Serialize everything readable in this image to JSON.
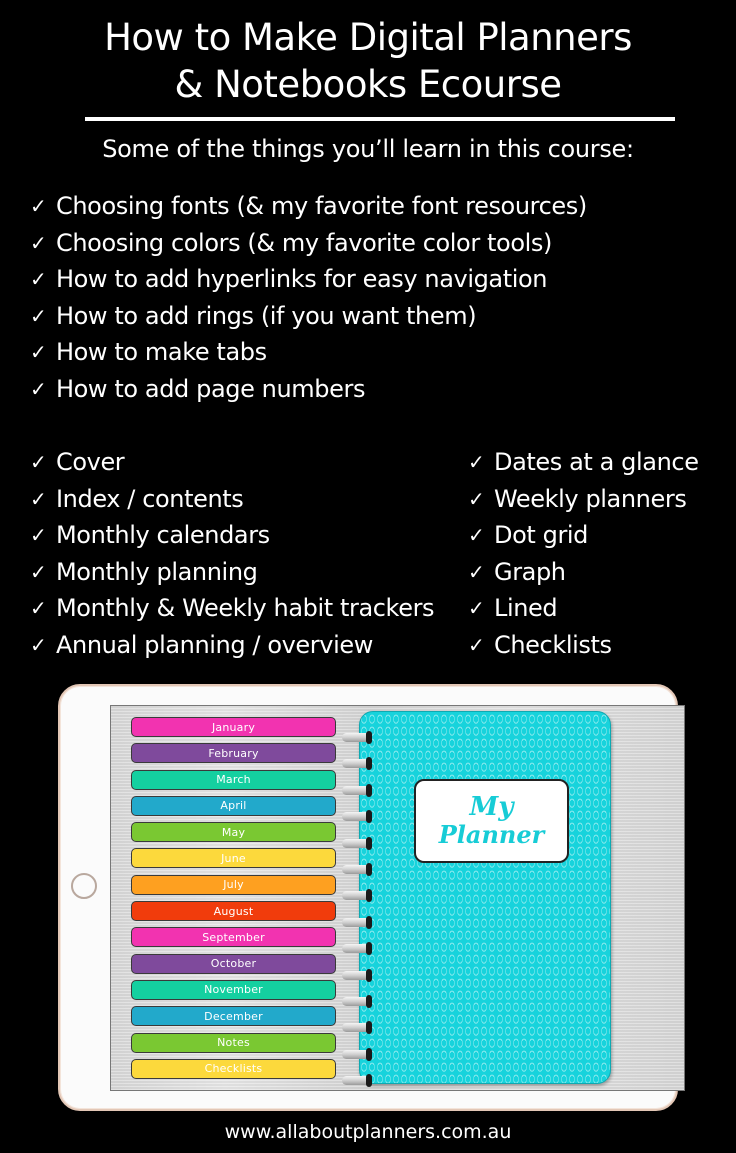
{
  "header": {
    "title_line1": "How to Make Digital Planners",
    "title_line2": "& Notebooks Ecourse",
    "subtitle": "Some of the things you’ll learn in this course:"
  },
  "check_icon": "✓",
  "skills": [
    "Choosing fonts (& my favorite font resources)",
    "Choosing colors (& my favorite color tools)",
    "How to add hyperlinks for easy navigation",
    "How to add rings (if you want them)",
    "How to make tabs",
    "How to add page numbers"
  ],
  "pages_left": [
    "Cover",
    "Index / contents",
    "Monthly calendars",
    "Monthly planning",
    "Monthly & Weekly habit trackers",
    "Annual planning / overview"
  ],
  "pages_right": [
    "Dates at a glance",
    "Weekly planners",
    "Dot grid",
    "Graph",
    "Lined",
    "Checklists"
  ],
  "planner": {
    "cover_title_line1": "My",
    "cover_title_line2": "Planner",
    "cover_color": "#17d3dc",
    "tabs": [
      {
        "label": "January",
        "color": "#f233b0"
      },
      {
        "label": "February",
        "color": "#7f4a9c"
      },
      {
        "label": "March",
        "color": "#14d0a0"
      },
      {
        "label": "April",
        "color": "#22a9cb"
      },
      {
        "label": "May",
        "color": "#7ac832"
      },
      {
        "label": "June",
        "color": "#fcd93c"
      },
      {
        "label": "July",
        "color": "#fea020"
      },
      {
        "label": "August",
        "color": "#f13c0c"
      },
      {
        "label": "September",
        "color": "#f233b0"
      },
      {
        "label": "October",
        "color": "#7f4a9c"
      },
      {
        "label": "November",
        "color": "#14d0a0"
      },
      {
        "label": "December",
        "color": "#22a9cb"
      },
      {
        "label": "Notes",
        "color": "#7ac832"
      },
      {
        "label": "Checklists",
        "color": "#fcd93c"
      }
    ],
    "ring_count": 14
  },
  "footer": {
    "website": "www.allaboutplanners.com.au"
  }
}
